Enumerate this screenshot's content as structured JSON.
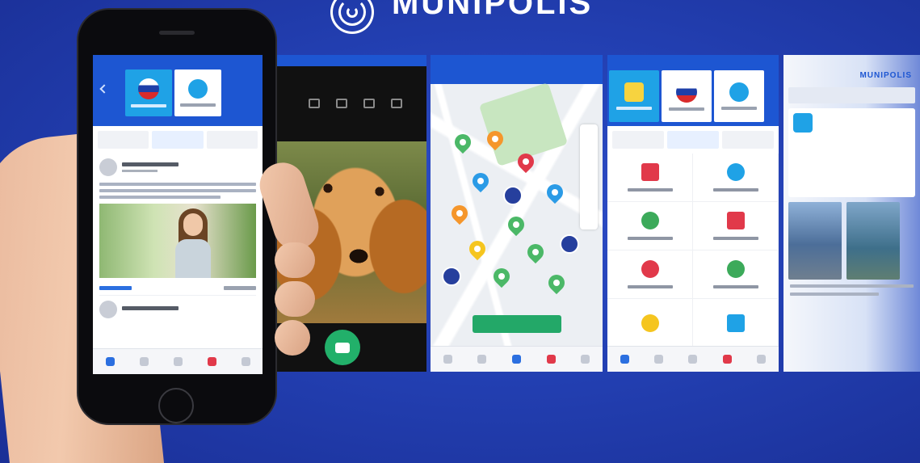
{
  "brand": {
    "name": "MUNIPOLIS"
  },
  "screens": {
    "phone": {
      "tabs_label": "",
      "post_title": "",
      "has_photo": true
    },
    "camera": {
      "shutter_icon": "camera-icon"
    },
    "map": {
      "report_button_label": ""
    },
    "grid": {
      "title": ""
    },
    "news": {
      "app_name": "MUNIPOLIS"
    }
  },
  "colors": {
    "background": "#2340b3",
    "app_header": "#1d56d2",
    "accent_green": "#23a868",
    "accent_cyan": "#1fa2e6"
  }
}
